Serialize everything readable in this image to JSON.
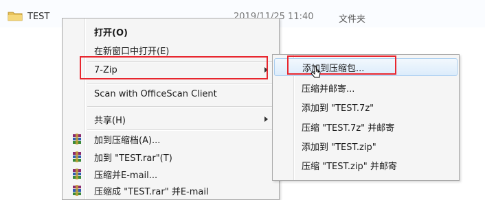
{
  "file_row": {
    "name": "TEST",
    "date": "2019/11/25 11:40",
    "type": "文件夹"
  },
  "context_menu": {
    "items": [
      {
        "label": "打开(O)"
      },
      {
        "label": "在新窗口中打开(E)"
      },
      {
        "label": "7-Zip"
      },
      {
        "label": "Scan with OfficeScan Client"
      },
      {
        "label": "共享(H)"
      },
      {
        "label": "加到压缩档(A)..."
      },
      {
        "label": "加到 \"TEST.rar\"(T)"
      },
      {
        "label": "压缩并E-mail..."
      },
      {
        "label": "压缩成 \"TEST.rar\" 并E-mail"
      }
    ]
  },
  "submenu": {
    "items": [
      {
        "label": "添加到压缩包..."
      },
      {
        "label": "压缩并邮寄..."
      },
      {
        "label": "添加到 \"TEST.7z\""
      },
      {
        "label": "压缩 \"TEST.7z\" 并邮寄"
      },
      {
        "label": "添加到 \"TEST.zip\""
      },
      {
        "label": "压缩 \"TEST.zip\" 并邮寄"
      }
    ]
  },
  "colors": {
    "highlight_frame": "#e8262e",
    "menu_background": "#f5f5f5",
    "hover_background": "#dcecfb"
  },
  "icons": {
    "folder": "folder-icon",
    "winrar": "winrar-archive-icon",
    "submenu_arrow": "chevron-right-icon",
    "cursor": "mouse-pointer-icon"
  }
}
